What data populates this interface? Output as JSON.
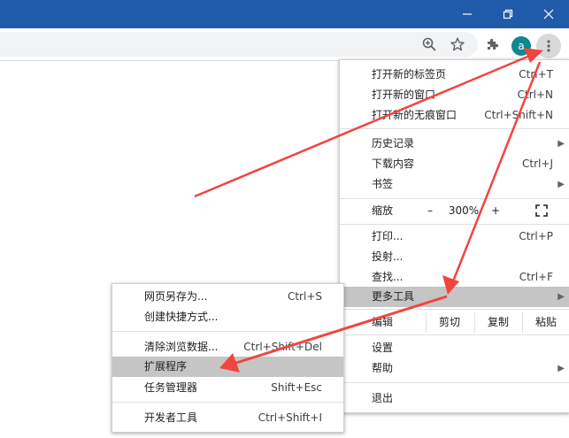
{
  "titlebar": {
    "minimize_icon": "minimize-icon",
    "restore_icon": "restore-icon",
    "close_icon": "close-icon"
  },
  "toolbar": {
    "avatar_letter": "a"
  },
  "main_menu": {
    "new_tab": {
      "label": "打开新的标签页",
      "accel": "Ctrl+T"
    },
    "new_window": {
      "label": "打开新的窗口",
      "accel": "Ctrl+N"
    },
    "new_incognito": {
      "label": "打开新的无痕窗口",
      "accel": "Ctrl+Shift+N"
    },
    "history": {
      "label": "历史记录"
    },
    "downloads": {
      "label": "下载内容",
      "accel": "Ctrl+J"
    },
    "bookmarks": {
      "label": "书签"
    },
    "zoom": {
      "label": "缩放",
      "minus": "–",
      "value": "300%",
      "plus": "+"
    },
    "print": {
      "label": "打印...",
      "accel": "Ctrl+P"
    },
    "cast": {
      "label": "投射..."
    },
    "find": {
      "label": "查找...",
      "accel": "Ctrl+F"
    },
    "more_tools": {
      "label": "更多工具"
    },
    "edit": {
      "label": "编辑",
      "cut": "剪切",
      "copy": "复制",
      "paste": "粘贴"
    },
    "settings": {
      "label": "设置"
    },
    "help": {
      "label": "帮助"
    },
    "exit": {
      "label": "退出"
    }
  },
  "sub_menu": {
    "save_as": {
      "label": "网页另存为...",
      "accel": "Ctrl+S"
    },
    "create_shortcut": {
      "label": "创建快捷方式..."
    },
    "clear_data": {
      "label": "清除浏览数据...",
      "accel": "Ctrl+Shift+Del"
    },
    "extensions": {
      "label": "扩展程序"
    },
    "task_manager": {
      "label": "任务管理器",
      "accel": "Shift+Esc"
    },
    "dev_tools": {
      "label": "开发者工具",
      "accel": "Ctrl+Shift+I"
    }
  },
  "colors": {
    "titlebar": "#1f5ba8",
    "highlight": "#c5c5c5",
    "arrow": "#f2453d",
    "avatar": "#11878f"
  }
}
